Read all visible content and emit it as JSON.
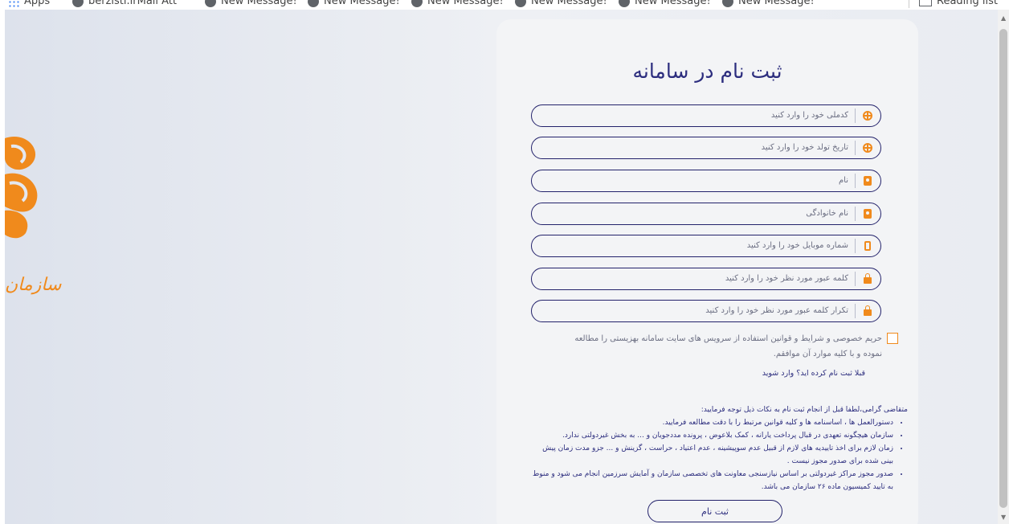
{
  "bookmarks_bar": {
    "items": [
      {
        "label": "Apps",
        "icon": "apps-grid-icon"
      },
      {
        "label": "berzisti.irMail Att",
        "icon": "globe-icon"
      },
      {
        "label": "New Message!",
        "icon": "globe-icon"
      },
      {
        "label": "New Message!",
        "icon": "globe-icon"
      },
      {
        "label": "New Message!",
        "icon": "globe-icon"
      },
      {
        "label": "New Message!",
        "icon": "globe-icon"
      },
      {
        "label": "New Message!",
        "icon": "globe-icon"
      },
      {
        "label": "New Message!",
        "icon": "globe-icon"
      }
    ],
    "reading_list": "Reading list"
  },
  "logo": {
    "text": "سازمان"
  },
  "form": {
    "title": "ثبت نام در سامانه",
    "fields": [
      {
        "placeholder": "کدملی خود را وارد کنید",
        "icon": "globe-icon"
      },
      {
        "placeholder": "تاریخ تولد خود را وارد کنید",
        "icon": "globe-icon"
      },
      {
        "placeholder": "نام",
        "icon": "id-card-icon"
      },
      {
        "placeholder": "نام خانوادگی",
        "icon": "id-card-icon"
      },
      {
        "placeholder": "شماره موبایل خود را وارد کنید",
        "icon": "mobile-icon"
      },
      {
        "placeholder": "کلمه عبور مورد نظر خود را وارد کنید",
        "icon": "lock-icon"
      },
      {
        "placeholder": "تکرار کلمه عبور مورد نظر خود را وارد کنید",
        "icon": "lock-icon"
      }
    ],
    "consent_text": "حریم خصوصی و شرایط و قوانین استفاده از سرویس های سایت سامانه بهزیستی را مطالعه نموده و با کلیه موارد آن موافقم.",
    "consent_checked": false,
    "login_link": "قبلا ثبت نام کرده اید؟ وارد شوید",
    "notes_title": "متقاضی گرامی،لطفا قبل از انجام ثبت نام به نکات ذیل توجه فرمایید:",
    "notes": [
      "دستورالعمل ها ، اساسنامه ها و کلیه قوانین مرتبط را با دقت مطالعه فرمایید.",
      "سازمان هیچگونه تعهدی در قبال پرداخت یارانه ، کمک بلاعوض ، پرونده مددجویان و ... به بخش غیردولتی ندارد.",
      "زمان لازم برای اخذ تاییدیه های لازم از قبیل عدم سوپیشینه ، عدم اعتیاد ، حراست ، گزینش و ... جزو مدت زمان پیش بینی شده برای صدور مجوز نیست .",
      "صدور مجوز مراکز غیردولتی بر اساس نیازسنجی معاونت های تخصصی سازمان و آمایش سرزمین انجام می شود و منوط به تایید کمیسیون ماده ۲۶ سازمان می باشد."
    ],
    "submit_label": "ثبت نام"
  },
  "colors": {
    "accent": "#f08a1c",
    "primary": "#2c2d7e",
    "border": "#23226b"
  }
}
